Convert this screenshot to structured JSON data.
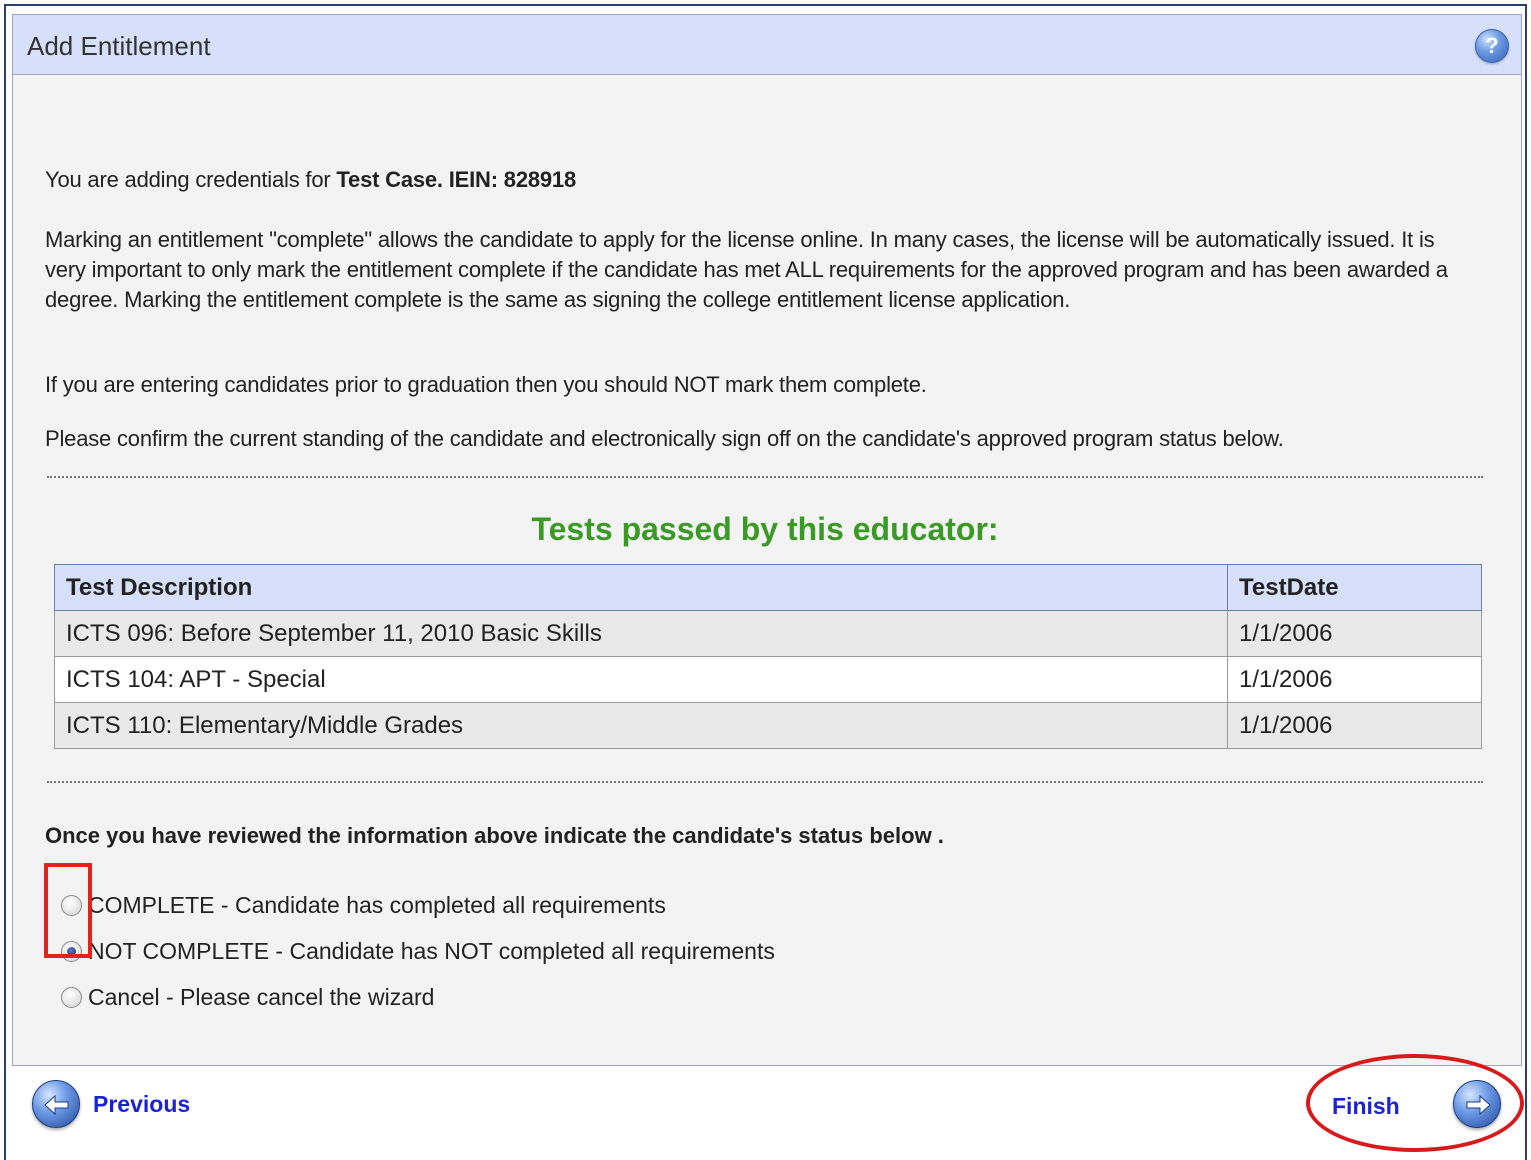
{
  "panel": {
    "title": "Add Entitlement",
    "help_icon": "help-icon"
  },
  "intro": {
    "prefix": "You are adding credentials for ",
    "candidate": "Test Case. IEIN: 828918"
  },
  "paragraphs": [
    "Marking an entitlement \"complete\" allows the candidate to apply for the license online. In many cases, the license will be automatically issued. It is very important to only mark the entitlement complete if the candidate has met ALL requirements for the approved program and has been awarded a degree. Marking the entitlement complete is the same as signing the college entitlement license application.",
    "If you are entering candidates prior to graduation then you should NOT mark them complete.",
    "Please confirm the current standing of the candidate and electronically sign off on the candidate's approved program status below."
  ],
  "tests": {
    "title": "Tests passed by this educator:",
    "columns": [
      "Test Description",
      "TestDate"
    ],
    "rows": [
      {
        "description": "ICTS 096: Before September 11, 2010 Basic Skills",
        "date": "1/1/2006"
      },
      {
        "description": "ICTS 104: APT - Special",
        "date": "1/1/2006"
      },
      {
        "description": "ICTS 110: Elementary/Middle Grades",
        "date": "1/1/2006"
      }
    ]
  },
  "review": {
    "prompt": "Once you have reviewed the information above indicate the candidate's status below .",
    "options": [
      {
        "label": "COMPLETE - Candidate has completed all requirements",
        "checked": false
      },
      {
        "label": "NOT COMPLETE - Candidate has NOT completed all requirements",
        "checked": true
      },
      {
        "label": "Cancel - Please cancel the wizard",
        "checked": false
      }
    ]
  },
  "nav": {
    "previous_label": "Previous",
    "finish_label": "Finish",
    "previous_icon": "arrow-left-icon",
    "next_icon": "arrow-right-icon"
  },
  "colors": {
    "header_bg": "#d6e0fa",
    "tests_title": "#3a9a25",
    "nav_link": "#1a22d6",
    "annotation_red": "#e0231b"
  }
}
